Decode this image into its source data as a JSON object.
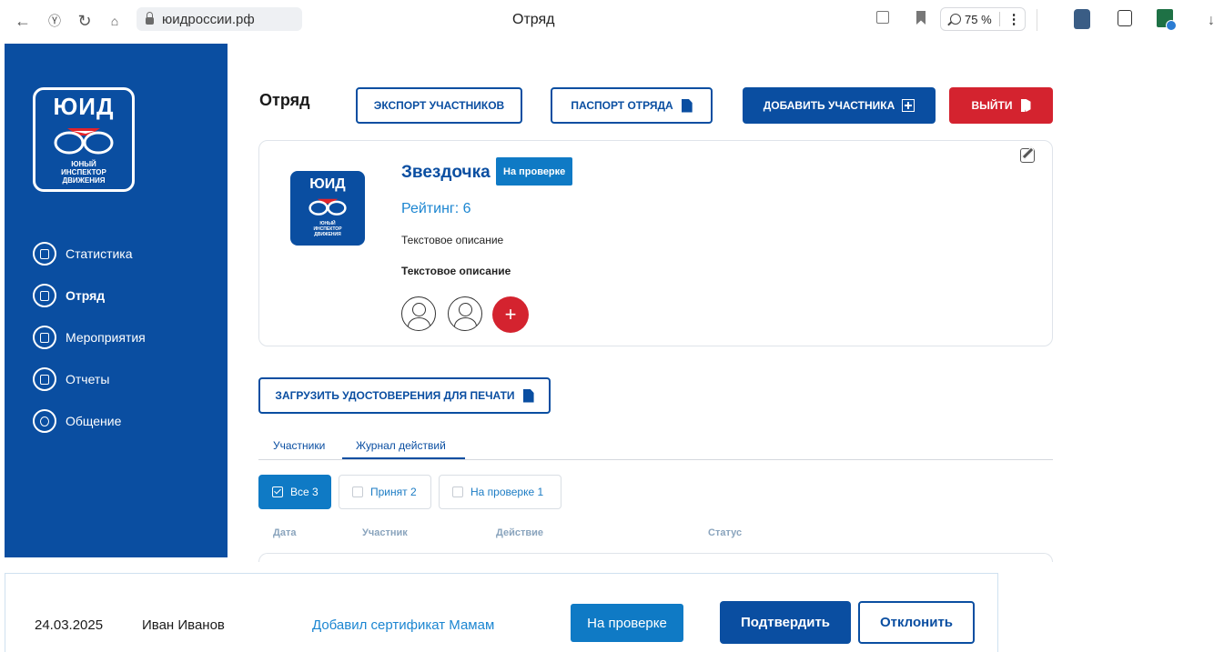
{
  "browser": {
    "address": "юидроссии.рф",
    "page_title": "Отряд",
    "zoom": "75 %",
    "menu_dots": "⋮"
  },
  "logo": {
    "title": "ЮИД",
    "subtitle_1": "ЮНЫЙ",
    "subtitle_2": "ИНСПЕКТОР",
    "subtitle_3": "ДВИЖЕНИЯ"
  },
  "sidebar": {
    "items": [
      {
        "label": "Статистика",
        "icon": "stats-icon"
      },
      {
        "label": "Отряд",
        "icon": "squad-icon",
        "active": true
      },
      {
        "label": "Мероприятия",
        "icon": "events-icon"
      },
      {
        "label": "Отчеты",
        "icon": "reports-icon"
      },
      {
        "label": "Общение",
        "icon": "chat-icon"
      }
    ]
  },
  "header": {
    "title": "Отряд",
    "export_label": "ЭКСПОРТ УЧАСТНИКОВ",
    "passport_label": "ПАСПОРТ ОТРЯДА",
    "add_member_label": "ДОБАВИТЬ УЧАСТНИКА",
    "logout_label": "ВЫЙТИ"
  },
  "squad": {
    "name": "Звездочка",
    "status": "На проверке",
    "rating": "Рейтинг: 6",
    "description": "Текстовое описание",
    "description_bold": "Текстовое описание",
    "add_member_symbol": "+"
  },
  "upload_label": "ЗАГРУЗИТЬ УДОСТОВЕРЕНИЯ ДЛЯ ПЕЧАТИ",
  "tabs": [
    {
      "label": "Участники"
    },
    {
      "label": "Журнал действий",
      "active": true
    }
  ],
  "filters": [
    {
      "label": "Все 3",
      "checked": true
    },
    {
      "label": "Принят 2",
      "checked": false
    },
    {
      "label": "На проверке 1",
      "checked": false
    }
  ],
  "table": {
    "headers": [
      "Дата",
      "Участник",
      "Действие",
      "Статус"
    ],
    "row": {
      "date": "24.03.2025",
      "member": "Иван Иванов",
      "action": "Добавил сертификат Мамам",
      "status": "На проверке",
      "confirm_label": "Подтвердить",
      "reject_label": "Отклонить"
    }
  },
  "colors": {
    "primary": "#0a4ea1",
    "accent_blue": "#0f7ac5",
    "danger": "#d4232f"
  }
}
